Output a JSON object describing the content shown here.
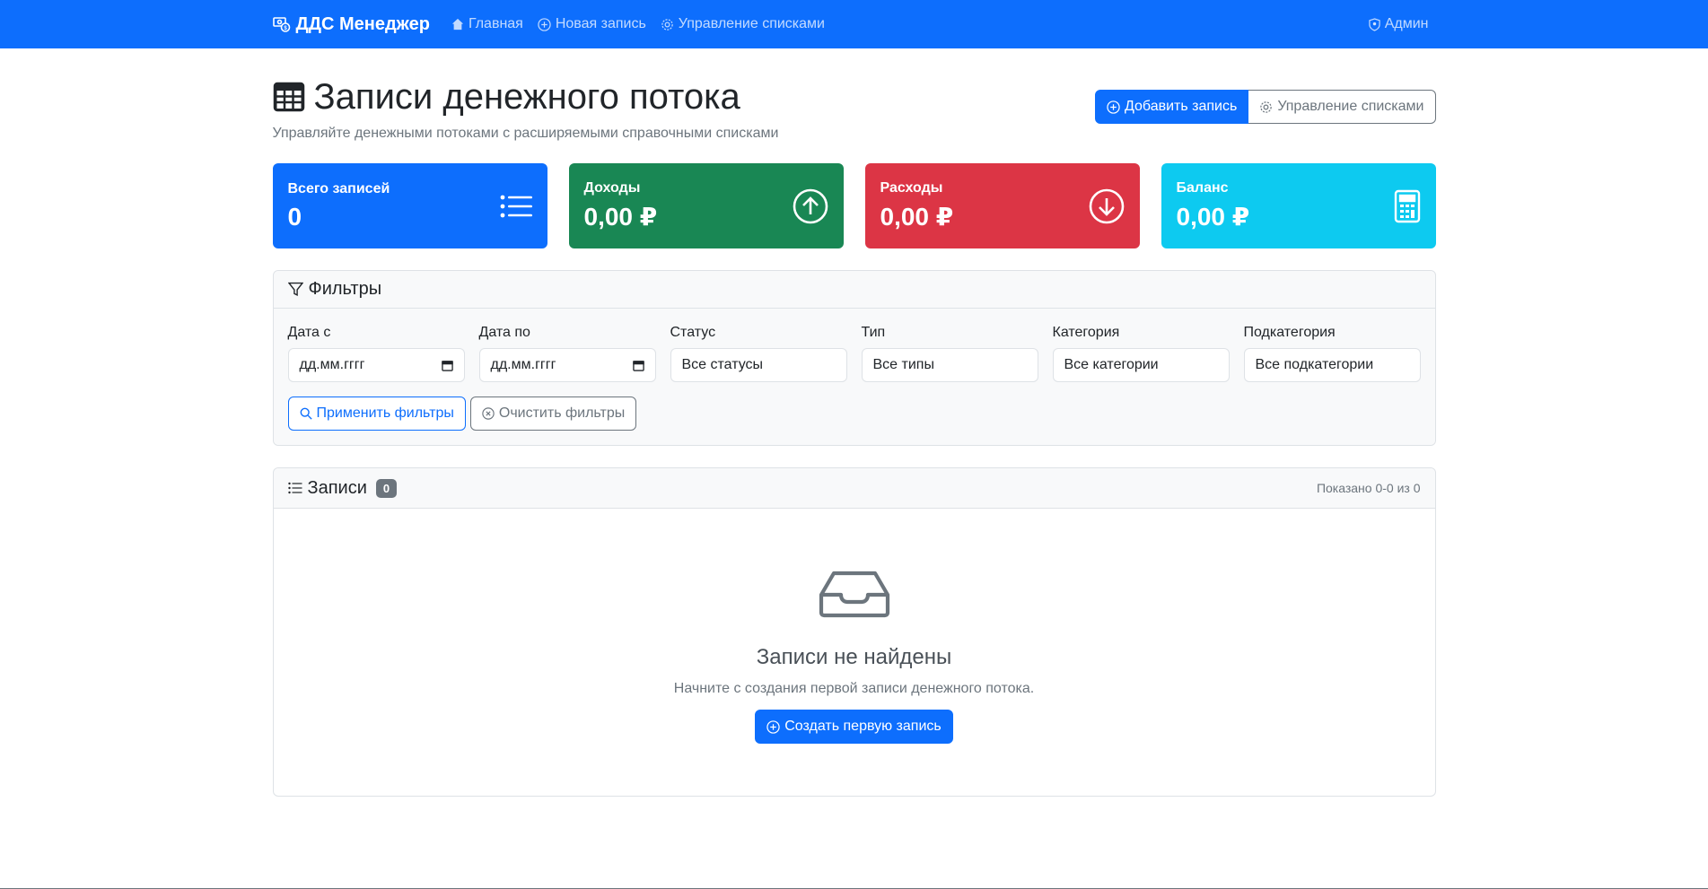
{
  "navbar": {
    "brand": "ДДС Менеджер",
    "links": [
      {
        "label": "Главная",
        "icon": "house-icon"
      },
      {
        "label": "Новая запись",
        "icon": "plus-circle-icon"
      },
      {
        "label": "Управление списками",
        "icon": "gear-icon"
      }
    ],
    "user": "Админ"
  },
  "header": {
    "title": "Записи денежного потока",
    "subtitle": "Управляйте денежными потоками с расширяемыми справочными списками",
    "add_button": "Добавить запись",
    "manage_button": "Управление списками"
  },
  "stats": [
    {
      "label": "Всего записей",
      "value": "0",
      "color": "#0d6efd",
      "icon": "list-icon"
    },
    {
      "label": "Доходы",
      "value": "0,00 ₽",
      "color": "#198754",
      "icon": "arrow-up-circle-icon"
    },
    {
      "label": "Расходы",
      "value": "0,00 ₽",
      "color": "#dc3545",
      "icon": "arrow-down-circle-icon"
    },
    {
      "label": "Баланс",
      "value": "0,00 ₽",
      "color": "#0dcaf0",
      "icon": "calculator-icon"
    }
  ],
  "filters": {
    "title": "Фильтры",
    "date_from": {
      "label": "Дата с",
      "placeholder": "дд.мм.гггг"
    },
    "date_to": {
      "label": "Дата по",
      "placeholder": "дд.мм.гггг"
    },
    "status": {
      "label": "Статус",
      "value": "Все статусы"
    },
    "type": {
      "label": "Тип",
      "value": "Все типы"
    },
    "category": {
      "label": "Категория",
      "value": "Все категории"
    },
    "subcategory": {
      "label": "Подкатегория",
      "value": "Все подкатегории"
    },
    "apply": "Применить фильтры",
    "clear": "Очистить фильтры"
  },
  "records": {
    "title": "Записи",
    "count": "0",
    "shown": "Показано 0-0 из 0",
    "empty_title": "Записи не найдены",
    "empty_text": "Начните с создания первой записи денежного потока.",
    "create_button": "Создать первую запись"
  }
}
